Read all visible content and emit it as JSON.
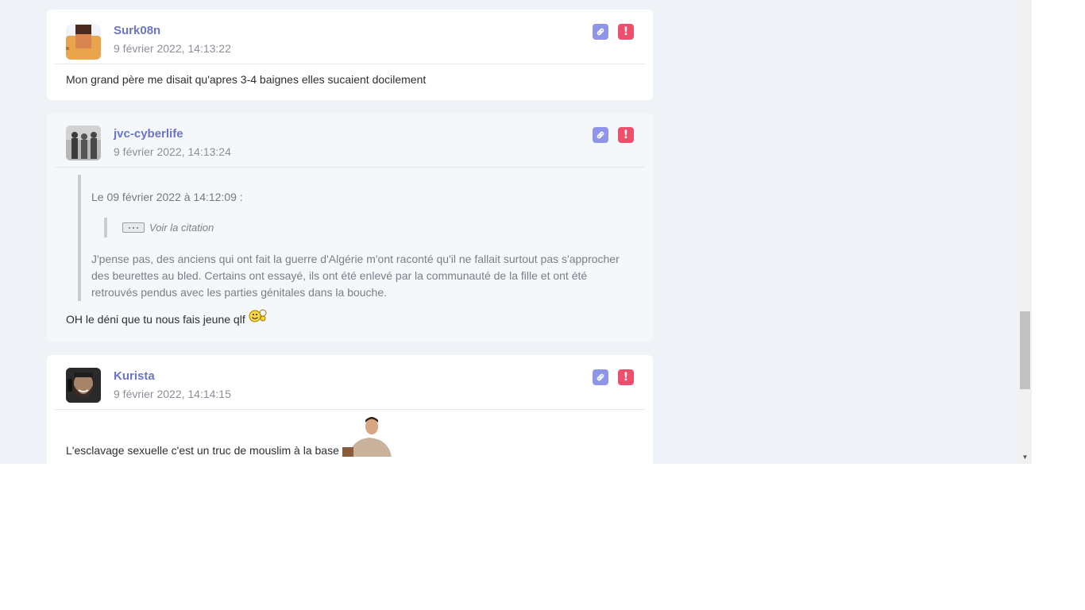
{
  "posts": [
    {
      "author": "Surk08n",
      "date": "9 février 2022, 14:13:22",
      "message": "Mon grand père me disait qu'apres 3-4 baignes elles sucaient docilement"
    },
    {
      "author": "jvc-cyberlife",
      "date": "9 février 2022, 14:13:24",
      "quote": {
        "header": "Le 09 février 2022 à 14:12:09 :",
        "nested_label": "Voir la citation",
        "text": "J'pense pas, des anciens qui ont fait la guerre d'Algérie m'ont raconté qu'il ne fallait surtout pas s'approcher des beurettes au bled. Certains ont essayé, ils ont été enlevé par la communauté de la fille et ont été retrouvés pendus avec les parties génitales dans la bouche."
      },
      "message": "OH le déni que tu nous fais jeune qlf"
    },
    {
      "author": "Kurista",
      "date": "9 février 2022, 14:14:15",
      "message": "L'esclavage sexuelle c'est un truc de mouslim à la base"
    }
  ],
  "icons": {
    "link": "link-icon",
    "report": "exclamation-icon"
  },
  "colors": {
    "author": "#6c74c7",
    "link_button": "#8f95e8",
    "report_button": "#ee4f6c"
  }
}
